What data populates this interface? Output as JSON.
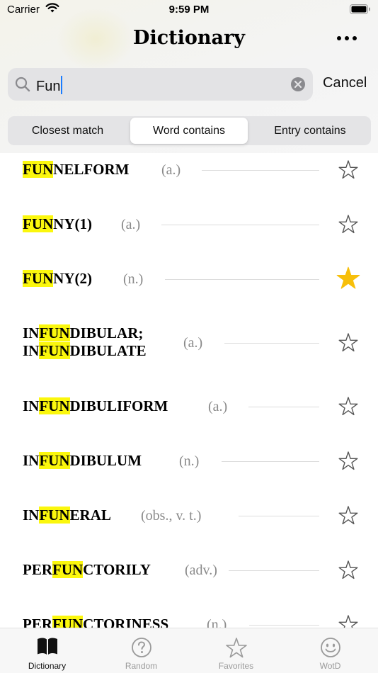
{
  "status_bar": {
    "carrier": "Carrier",
    "time": "9:59 PM"
  },
  "nav": {
    "title": "Dictionary",
    "more_icon": "ellipsis-icon"
  },
  "search": {
    "value": "Fun",
    "placeholder": "Search",
    "cancel_label": "Cancel"
  },
  "segments": [
    {
      "label": "Closest match",
      "selected": false
    },
    {
      "label": "Word contains",
      "selected": true
    },
    {
      "label": "Entry contains",
      "selected": false
    }
  ],
  "results": [
    {
      "pre": "",
      "match": "FUN",
      "post": "NELFORM",
      "pre2": "",
      "match2": "",
      "post2": "",
      "pos": "(a.)",
      "favorite": false
    },
    {
      "pre": "",
      "match": "FUN",
      "post": "NY(1)",
      "pre2": "",
      "match2": "",
      "post2": "",
      "pos": "(a.)",
      "favorite": false
    },
    {
      "pre": "",
      "match": "FUN",
      "post": "NY(2)",
      "pre2": "",
      "match2": "",
      "post2": "",
      "pos": "(n.)",
      "favorite": true
    },
    {
      "pre": "IN",
      "match": "FUN",
      "post": "DIBULAR;",
      "pre2": "IN",
      "match2": "FUN",
      "post2": "DIBULATE",
      "pos": "(a.)",
      "favorite": false
    },
    {
      "pre": "IN",
      "match": "FUN",
      "post": "DIBULIFORM",
      "pre2": "",
      "match2": "",
      "post2": "",
      "pos": "(a.)",
      "favorite": false
    },
    {
      "pre": "IN",
      "match": "FUN",
      "post": "DIBULUM",
      "pre2": "",
      "match2": "",
      "post2": "",
      "pos": "(n.)",
      "favorite": false
    },
    {
      "pre": "IN",
      "match": "FUN",
      "post": "ERAL",
      "pre2": "",
      "match2": "",
      "post2": "",
      "pos": "(obs., v. t.)",
      "favorite": false
    },
    {
      "pre": "PER",
      "match": "FUN",
      "post": "CTORILY",
      "pre2": "",
      "match2": "",
      "post2": "",
      "pos": "(adv.)",
      "favorite": false
    },
    {
      "pre": "PER",
      "match": "FUN",
      "post": "CTORINESS",
      "pre2": "",
      "match2": "",
      "post2": "",
      "pos": "(n.)",
      "favorite": false
    }
  ],
  "tabs": [
    {
      "label": "Dictionary",
      "icon": "book-icon",
      "active": true
    },
    {
      "label": "Random",
      "icon": "question-circle-icon",
      "active": false
    },
    {
      "label": "Favorites",
      "icon": "star-icon",
      "active": false
    },
    {
      "label": "WotD",
      "icon": "smiley-icon",
      "active": false
    }
  ],
  "colors": {
    "highlight": "#fbf70d",
    "favorite": "#f7bf0a",
    "accent": "#1a7cff"
  }
}
